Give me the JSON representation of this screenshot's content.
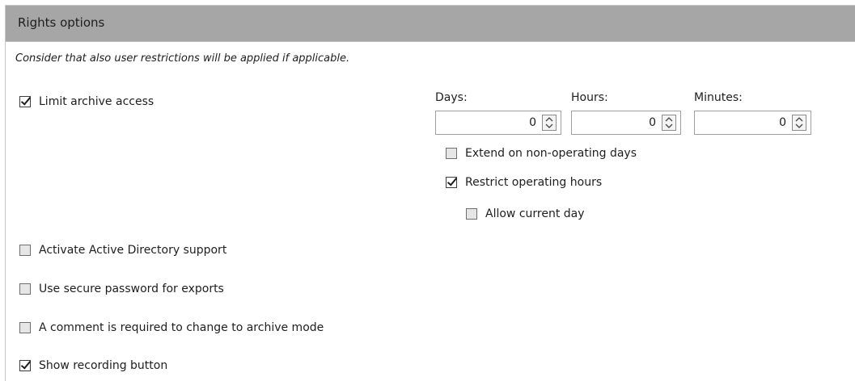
{
  "header": {
    "title": "Rights options"
  },
  "note": "Consider that also user restrictions will be applied if applicable.",
  "options": {
    "limit_archive_access": {
      "label": "Limit archive access",
      "checked": true
    },
    "active_directory": {
      "label": "Activate Active Directory support",
      "checked": false
    },
    "secure_password": {
      "label": "Use secure password for exports",
      "checked": false
    },
    "comment_required": {
      "label": "A comment is required to change to archive mode",
      "checked": false
    },
    "show_recording": {
      "label": "Show recording button",
      "checked": true
    }
  },
  "time_limits": {
    "days": {
      "label": "Days:",
      "value": "0"
    },
    "hours": {
      "label": "Hours:",
      "value": "0"
    },
    "minutes": {
      "label": "Minutes:",
      "value": "0"
    }
  },
  "sub_options": {
    "extend_non_operating": {
      "label": "Extend on non-operating days",
      "checked": false
    },
    "restrict_operating": {
      "label": "Restrict operating hours",
      "checked": true
    },
    "allow_current_day": {
      "label": "Allow current day",
      "checked": false
    }
  },
  "icons": {
    "spin": "up-down-spinner-icon",
    "check": "checkmark-icon"
  }
}
